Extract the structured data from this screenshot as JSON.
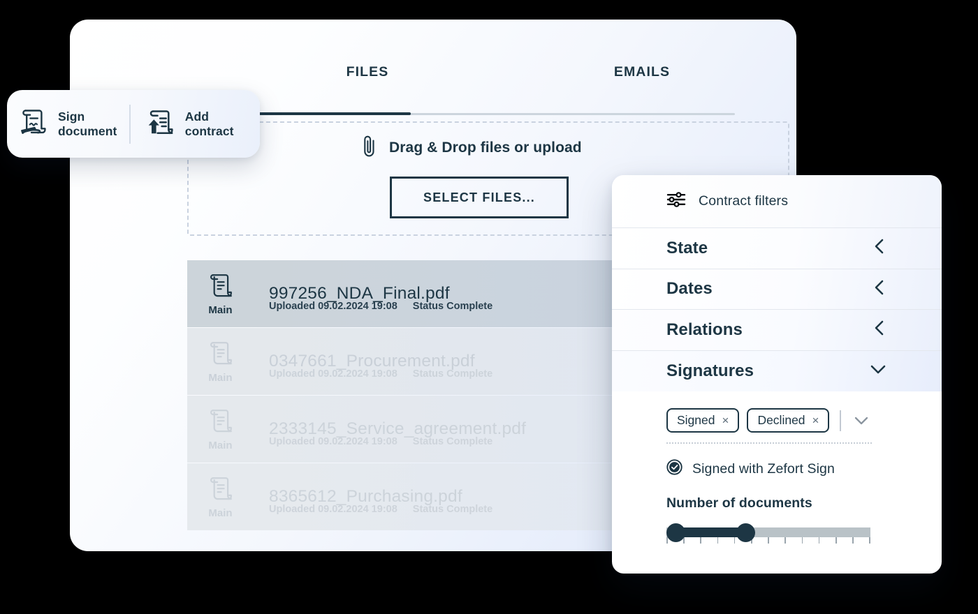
{
  "tabs": [
    {
      "label": "FILES",
      "active": true
    },
    {
      "label": "EMAILS",
      "active": false
    }
  ],
  "actions": {
    "sign_document": {
      "label_line1": "Sign",
      "label_line2": "document",
      "icon": "signed-document-icon"
    },
    "add_contract": {
      "label_line1": "Add",
      "label_line2": "contract",
      "icon": "upload-document-icon"
    }
  },
  "dropzone": {
    "icon": "paperclip-icon",
    "text": "Drag & Drop files or upload",
    "button_label": "SELECT FILES..."
  },
  "files": [
    {
      "badge": "Main",
      "name": "997256_NDA_Final.pdf",
      "uploaded": "Uploaded 09.02.2024 19:08",
      "status": "Status Complete",
      "selected": true
    },
    {
      "badge": "Main",
      "name": "0347661_Procurement.pdf",
      "uploaded": "Uploaded 09.02.2024 19:08",
      "status": "Status Complete",
      "selected": false
    },
    {
      "badge": "Main",
      "name": "2333145_Service_agreement.pdf",
      "uploaded": "Uploaded 09.02.2024 19:08",
      "status": "Status Complete",
      "selected": false
    },
    {
      "badge": "Main",
      "name": "8365612_Purchasing.pdf",
      "uploaded": "Uploaded 09.02.2024 19:08",
      "status": "Status Complete",
      "selected": false
    }
  ],
  "filters": {
    "title": "Contract filters",
    "title_icon": "sliders-icon",
    "rows": [
      {
        "label": "State",
        "state": "collapsed",
        "chevron": "chevron-left-icon"
      },
      {
        "label": "Dates",
        "state": "collapsed",
        "chevron": "chevron-left-icon"
      },
      {
        "label": "Relations",
        "state": "collapsed",
        "chevron": "chevron-left-icon"
      },
      {
        "label": "Signatures",
        "state": "expanded",
        "chevron": "chevron-down-icon"
      }
    ],
    "signatures": {
      "chips": [
        {
          "label": "Signed",
          "remove": "×"
        },
        {
          "label": "Declined",
          "remove": "×"
        }
      ],
      "dropdown_icon": "chevron-down-icon",
      "checkbox": {
        "label": "Signed with Zefort Sign",
        "checked": true,
        "icon": "check-circle-icon"
      },
      "slider": {
        "label": "Number of documents",
        "min_percent": 0,
        "max_percent": 38,
        "tick_count": 13
      }
    }
  },
  "colors": {
    "ink": "#1d3644",
    "muted": "#ccd3da",
    "track": "#b9c2c7",
    "dash_border": "#c9d2e0",
    "accent_surface": "#ccd4da"
  }
}
